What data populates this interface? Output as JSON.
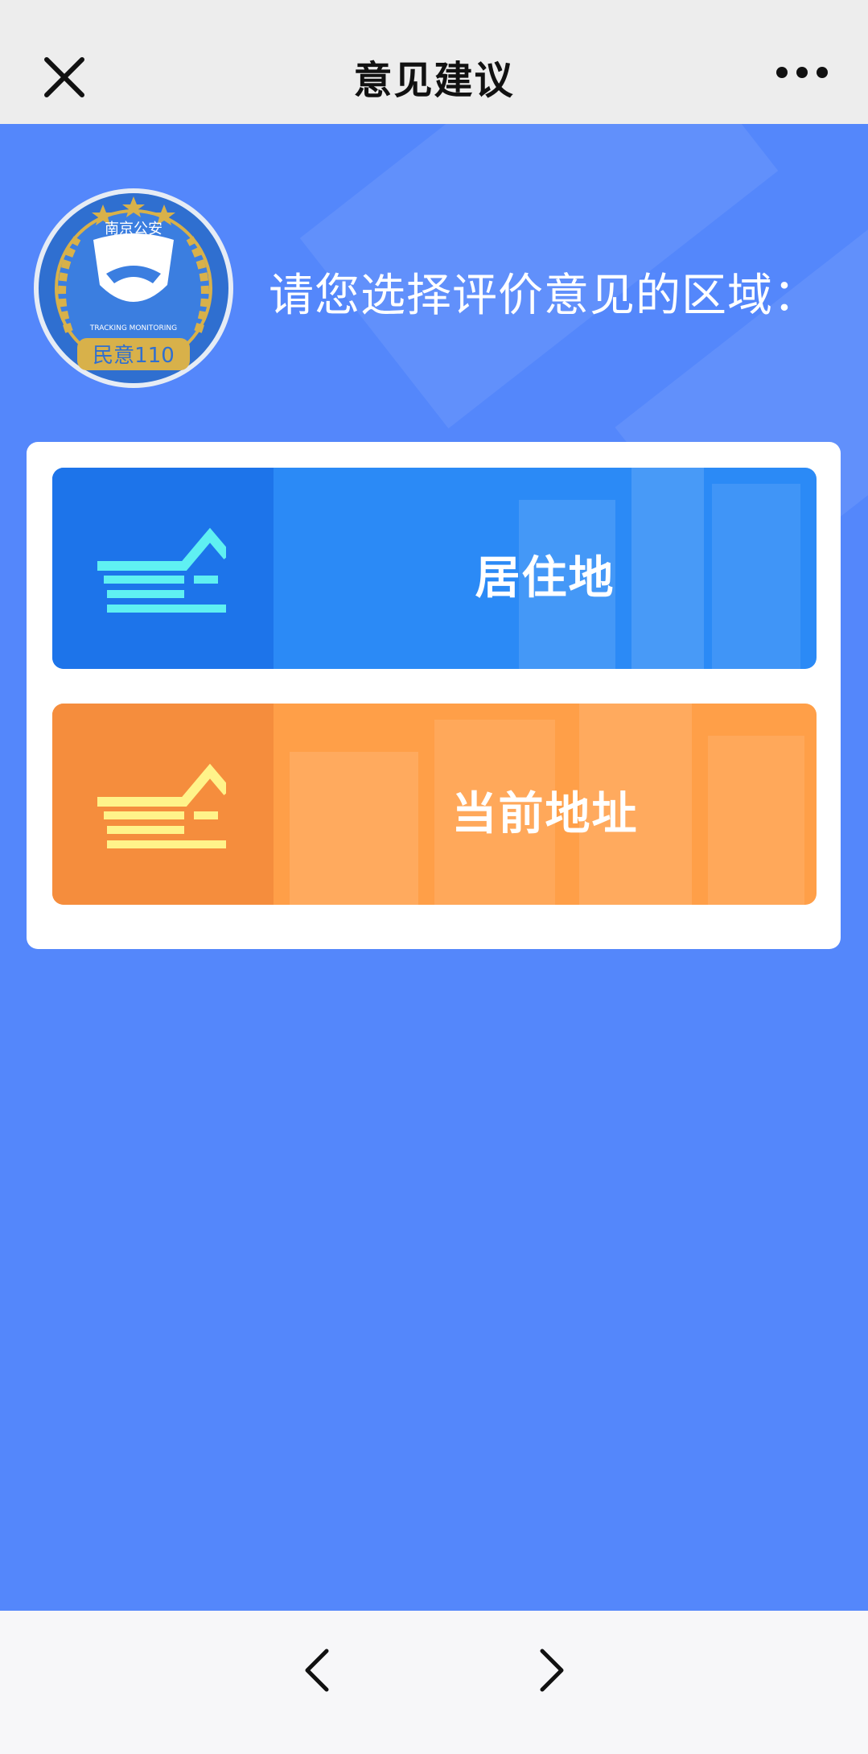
{
  "topbar": {
    "title": "意见建议",
    "close_icon": "close-icon",
    "more_icon": "more-icon"
  },
  "header": {
    "prompt": "请您选择评价意见的区域：",
    "badge": {
      "top_text": "南京公安",
      "ring_text": "TRACKING MONITORING",
      "bottom_text": "民意110",
      "colors": {
        "outer": "#2f6fd0",
        "gold": "#d8b14a"
      }
    }
  },
  "options": [
    {
      "label": "居住地",
      "icon": "house-icon",
      "color": "#2b8af6",
      "icon_color": "#5ff0f2"
    },
    {
      "label": "当前地址",
      "icon": "house-icon",
      "color": "#ff9f48",
      "icon_color": "#fff38a"
    }
  ],
  "bottombar": {
    "back_icon": "chevron-left-icon",
    "forward_icon": "chevron-right-icon"
  },
  "colors": {
    "page_blue": "#5487fb",
    "nav_bg": "#ededed"
  }
}
